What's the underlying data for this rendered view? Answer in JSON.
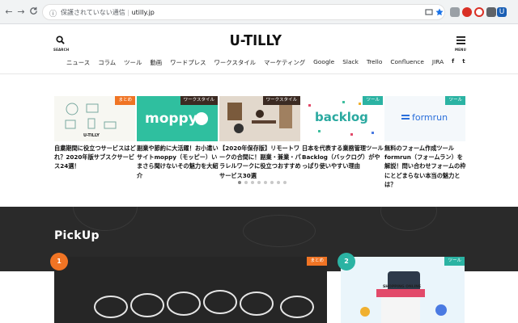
{
  "browser": {
    "security_text": "保護されていない通信",
    "url": "utilly.jp",
    "back_glyph": "←",
    "forward_glyph": "→",
    "reload_glyph": "C",
    "warn_glyph": "ⓘ",
    "extensions": [
      {
        "name": "camera-icon",
        "color": "#5f6368"
      },
      {
        "name": "star-icon",
        "color": "#1a73e8"
      },
      {
        "name": "record-icon",
        "color": "#d93025"
      },
      {
        "name": "target-icon",
        "color": "#d93025"
      },
      {
        "name": "puzzle-icon",
        "color": "#5f6368"
      },
      {
        "name": "profile-u-icon",
        "color": "#1a5fb4"
      }
    ],
    "ext_letter": "U"
  },
  "header": {
    "logo": "U-TILLY",
    "search_label": "SEARCH",
    "menu_label": "MENU",
    "nav": [
      "ニュース",
      "コラム",
      "ツール",
      "動画",
      "ワードプレス",
      "ワークスタイル",
      "マーケティング",
      "Google",
      "Slack",
      "Trello",
      "Confluence",
      "JIRA"
    ],
    "social": [
      "f",
      "t"
    ]
  },
  "slider": {
    "cards": [
      {
        "badge": "まとめ",
        "title": "自粛期間に役立つサービスはどれ？2020年版サブスクサービス24選！",
        "thumb_text": "U-TILLY"
      },
      {
        "badge": "ワークスタイル",
        "title": "副業や節約に大活躍！お小遣いサイトmoppy（モッピー）いまさら聞けないその魅力を大紹介",
        "thumb_text": "moppy"
      },
      {
        "badge": "ワークスタイル",
        "title": "【2020年保存版】リモートワークの合間に！副業・兼業・パラレルワークに役立つおすすめサービス30選",
        "thumb_text": ""
      },
      {
        "badge": "ツール",
        "title": "日本を代表する業務管理ツールBacklog（バックログ）がやっぱり使いやすい理由",
        "thumb_text": "backlog"
      },
      {
        "badge": "ツール",
        "title": "無料のフォーム作成ツールformrun（フォームラン）を解説！問い合わせフォームの枠にとどまらない本当の魅力とは？",
        "thumb_text": "formrun"
      }
    ],
    "dots": 8,
    "active_dot": 1
  },
  "pickup": {
    "title": "PickUp",
    "cards": [
      {
        "rank": "1",
        "badge": "まとめ"
      },
      {
        "rank": "2",
        "badge": "ツール",
        "thumb_text": "SHOPPING ONLINE"
      }
    ]
  },
  "colors": {
    "accent": "#f07424",
    "teal": "#2bb3a3",
    "pickup_bg": "#2a2a2a"
  }
}
